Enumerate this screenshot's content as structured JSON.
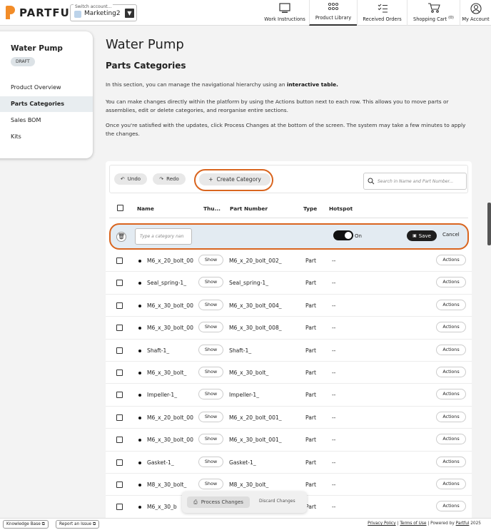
{
  "header": {
    "logo_text": "PARTFUL",
    "switch_label": "Switch account...",
    "account": "Marketing2",
    "nav": [
      {
        "label": "Work Instructions",
        "icon": "monitor-icon",
        "active": false
      },
      {
        "label": "Product Library",
        "icon": "grid-icon",
        "active": true
      },
      {
        "label": "Received Orders",
        "icon": "checklist-icon",
        "active": false
      },
      {
        "label": "Shopping Cart",
        "count": "(0)",
        "icon": "cart-icon",
        "active": false
      },
      {
        "label": "My Account",
        "icon": "user-icon",
        "active": false
      }
    ]
  },
  "sidebar": {
    "title": "Water Pump",
    "badge": "DRAFT",
    "items": [
      {
        "label": "Product Overview",
        "active": false
      },
      {
        "label": "Parts Categories",
        "active": true
      },
      {
        "label": "Sales BOM",
        "active": false
      },
      {
        "label": "Kits",
        "active": false
      }
    ]
  },
  "main": {
    "title": "Water Pump",
    "section_title": "Parts Categories",
    "intro_1_pre": "In this section, you can manage the navigational hierarchy using an ",
    "intro_1_bold": "interactive table.",
    "intro_2": "You can make changes directly within the platform by using the Actions button next to each row. This allows you to move parts or assemblies, edit or delete categories, and reorganise entire sections.",
    "intro_3": "Once you're satisfied with the updates, click Process Changes at the bottom of the screen. The system may take a few minutes to apply the changes."
  },
  "toolbar": {
    "undo": "Undo",
    "redo": "Redo",
    "create": "Create Category",
    "search_placeholder": "Search in Name and Part Number..."
  },
  "table": {
    "columns": {
      "name": "Name",
      "thumb": "Thu...",
      "part_number": "Part Number",
      "type": "Type",
      "hotspot": "Hotspot"
    },
    "edit_row": {
      "placeholder": "Type a category nan",
      "toggle_label": "On",
      "save": "Save",
      "cancel": "Cancel"
    },
    "show_label": "Show",
    "actions_label": "Actions",
    "rows": [
      {
        "name": "M6_x_20_bolt_00",
        "part_number": "M6_x_20_bolt_002_",
        "type": "Part",
        "hotspot": "--"
      },
      {
        "name": "Seal_spring-1_",
        "part_number": "Seal_spring-1_",
        "type": "Part",
        "hotspot": "--"
      },
      {
        "name": "M6_x_30_bolt_00",
        "part_number": "M6_x_30_bolt_004_",
        "type": "Part",
        "hotspot": "--"
      },
      {
        "name": "M6_x_30_bolt_00",
        "part_number": "M6_x_30_bolt_008_",
        "type": "Part",
        "hotspot": "--"
      },
      {
        "name": "Shaft-1_",
        "part_number": "Shaft-1_",
        "type": "Part",
        "hotspot": "--"
      },
      {
        "name": "M6_x_30_bolt_",
        "part_number": "M6_x_30_bolt_",
        "type": "Part",
        "hotspot": "--"
      },
      {
        "name": "Impeller-1_",
        "part_number": "Impeller-1_",
        "type": "Part",
        "hotspot": "--"
      },
      {
        "name": "M6_x_20_bolt_00",
        "part_number": "M6_x_20_bolt_001_",
        "type": "Part",
        "hotspot": "--"
      },
      {
        "name": "M6_x_30_bolt_00",
        "part_number": "M6_x_30_bolt_001_",
        "type": "Part",
        "hotspot": "--"
      },
      {
        "name": "Gasket-1_",
        "part_number": "Gasket-1_",
        "type": "Part",
        "hotspot": "--"
      },
      {
        "name": "M8_x_30_bolt_",
        "part_number": "M8_x_30_bolt_",
        "type": "Part",
        "hotspot": "--"
      },
      {
        "name": "M6_x_30_b",
        "part_number": "",
        "type": "Part",
        "hotspot": "--"
      }
    ]
  },
  "process": {
    "process_label": "Process Changes",
    "discard_label": "Discard Changes"
  },
  "footer": {
    "knowledge_base": "Knowledge Base",
    "report_issue": "Report an Issue",
    "privacy": "Privacy Policy",
    "terms": "Terms of Use",
    "powered_by": "Powered by",
    "brand": "Partful",
    "year": "2025"
  },
  "colors": {
    "brand_orange": "#f28c28",
    "highlight_ring": "#d9651f"
  }
}
